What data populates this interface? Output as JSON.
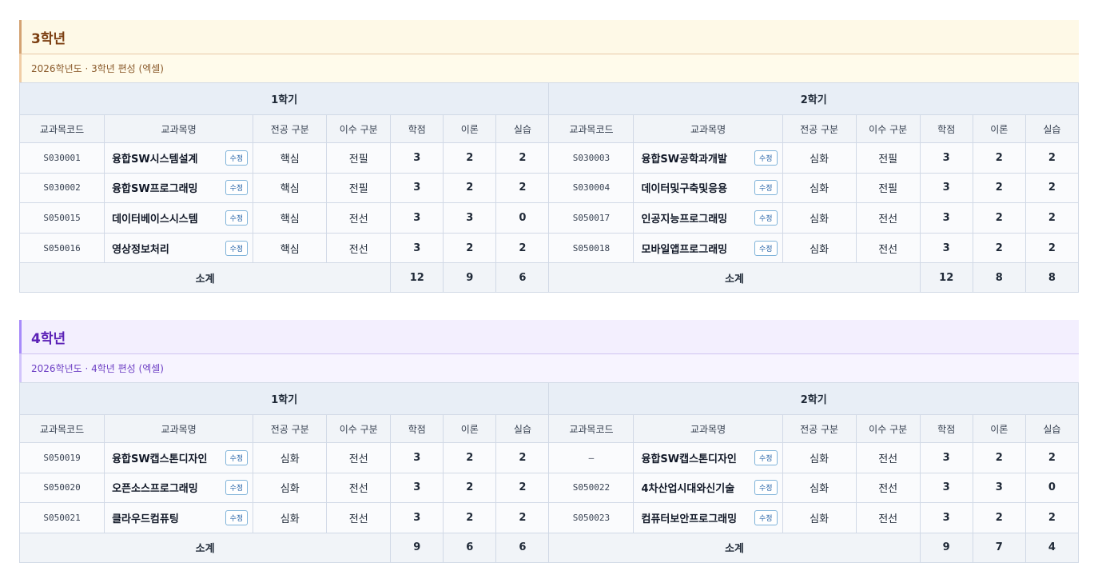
{
  "sections": [
    {
      "title": "3학년",
      "subtitle": "2026학년도 · 3학년 편성 (엑셀)",
      "semesters": [
        "1학기",
        "2학기"
      ],
      "columns": [
        "교과목코드",
        "교과목명",
        "전공 구분",
        "이수 구분",
        "학점",
        "이론",
        "실습"
      ],
      "edit_label": "수정",
      "subtotal_label": "소계",
      "rows": [
        [
          {
            "code": "S030001",
            "name": "융합SW시스템설계",
            "major": "핵심",
            "completion": "전필",
            "credit": "3",
            "theory": "2",
            "practice": "2"
          },
          {
            "code": "S030003",
            "name": "융합SW공학과개발",
            "major": "심화",
            "completion": "전필",
            "credit": "3",
            "theory": "2",
            "practice": "2"
          }
        ],
        [
          {
            "code": "S030002",
            "name": "융합SW프로그래밍",
            "major": "핵심",
            "completion": "전필",
            "credit": "3",
            "theory": "2",
            "practice": "2"
          },
          {
            "code": "S030004",
            "name": "데이터및구축및응용",
            "major": "심화",
            "completion": "전필",
            "credit": "3",
            "theory": "2",
            "practice": "2"
          }
        ],
        [
          {
            "code": "S050015",
            "name": "데이터베이스시스템",
            "major": "핵심",
            "completion": "전선",
            "credit": "3",
            "theory": "3",
            "practice": "0"
          },
          {
            "code": "S050017",
            "name": "인공지능프로그래밍",
            "major": "심화",
            "completion": "전선",
            "credit": "3",
            "theory": "2",
            "practice": "2"
          }
        ],
        [
          {
            "code": "S050016",
            "name": "영상정보처리",
            "major": "핵심",
            "completion": "전선",
            "credit": "3",
            "theory": "2",
            "practice": "2"
          },
          {
            "code": "S050018",
            "name": "모바일앱프로그래밍",
            "major": "심화",
            "completion": "전선",
            "credit": "3",
            "theory": "2",
            "practice": "2"
          }
        ]
      ],
      "subtotals": [
        {
          "credit": "12",
          "theory": "9",
          "practice": "6"
        },
        {
          "credit": "12",
          "theory": "8",
          "practice": "8"
        }
      ]
    },
    {
      "title": "4학년",
      "subtitle": "2026학년도 · 4학년 편성 (엑셀)",
      "semesters": [
        "1학기",
        "2학기"
      ],
      "columns": [
        "교과목코드",
        "교과목명",
        "전공 구분",
        "이수 구분",
        "학점",
        "이론",
        "실습"
      ],
      "edit_label": "수정",
      "subtotal_label": "소계",
      "rows": [
        [
          {
            "code": "S050019",
            "name": "융합SW캡스톤디자인",
            "major": "심화",
            "completion": "전선",
            "credit": "3",
            "theory": "2",
            "practice": "2"
          },
          {
            "code": "–",
            "name": "융합SW캡스톤디자인",
            "major": "심화",
            "completion": "전선",
            "credit": "3",
            "theory": "2",
            "practice": "2"
          }
        ],
        [
          {
            "code": "S050020",
            "name": "오픈소스프로그래밍",
            "major": "심화",
            "completion": "전선",
            "credit": "3",
            "theory": "2",
            "practice": "2"
          },
          {
            "code": "S050022",
            "name": "4차산업시대와신기술",
            "major": "심화",
            "completion": "전선",
            "credit": "3",
            "theory": "3",
            "practice": "0"
          }
        ],
        [
          {
            "code": "S050021",
            "name": "클라우드컴퓨팅",
            "major": "심화",
            "completion": "전선",
            "credit": "3",
            "theory": "2",
            "practice": "2"
          },
          {
            "code": "S050023",
            "name": "컴퓨터보안프로그래밍",
            "major": "심화",
            "completion": "전선",
            "credit": "3",
            "theory": "2",
            "practice": "2"
          }
        ]
      ],
      "subtotals": [
        {
          "credit": "9",
          "theory": "6",
          "practice": "6"
        },
        {
          "credit": "9",
          "theory": "7",
          "practice": "4"
        }
      ]
    }
  ]
}
